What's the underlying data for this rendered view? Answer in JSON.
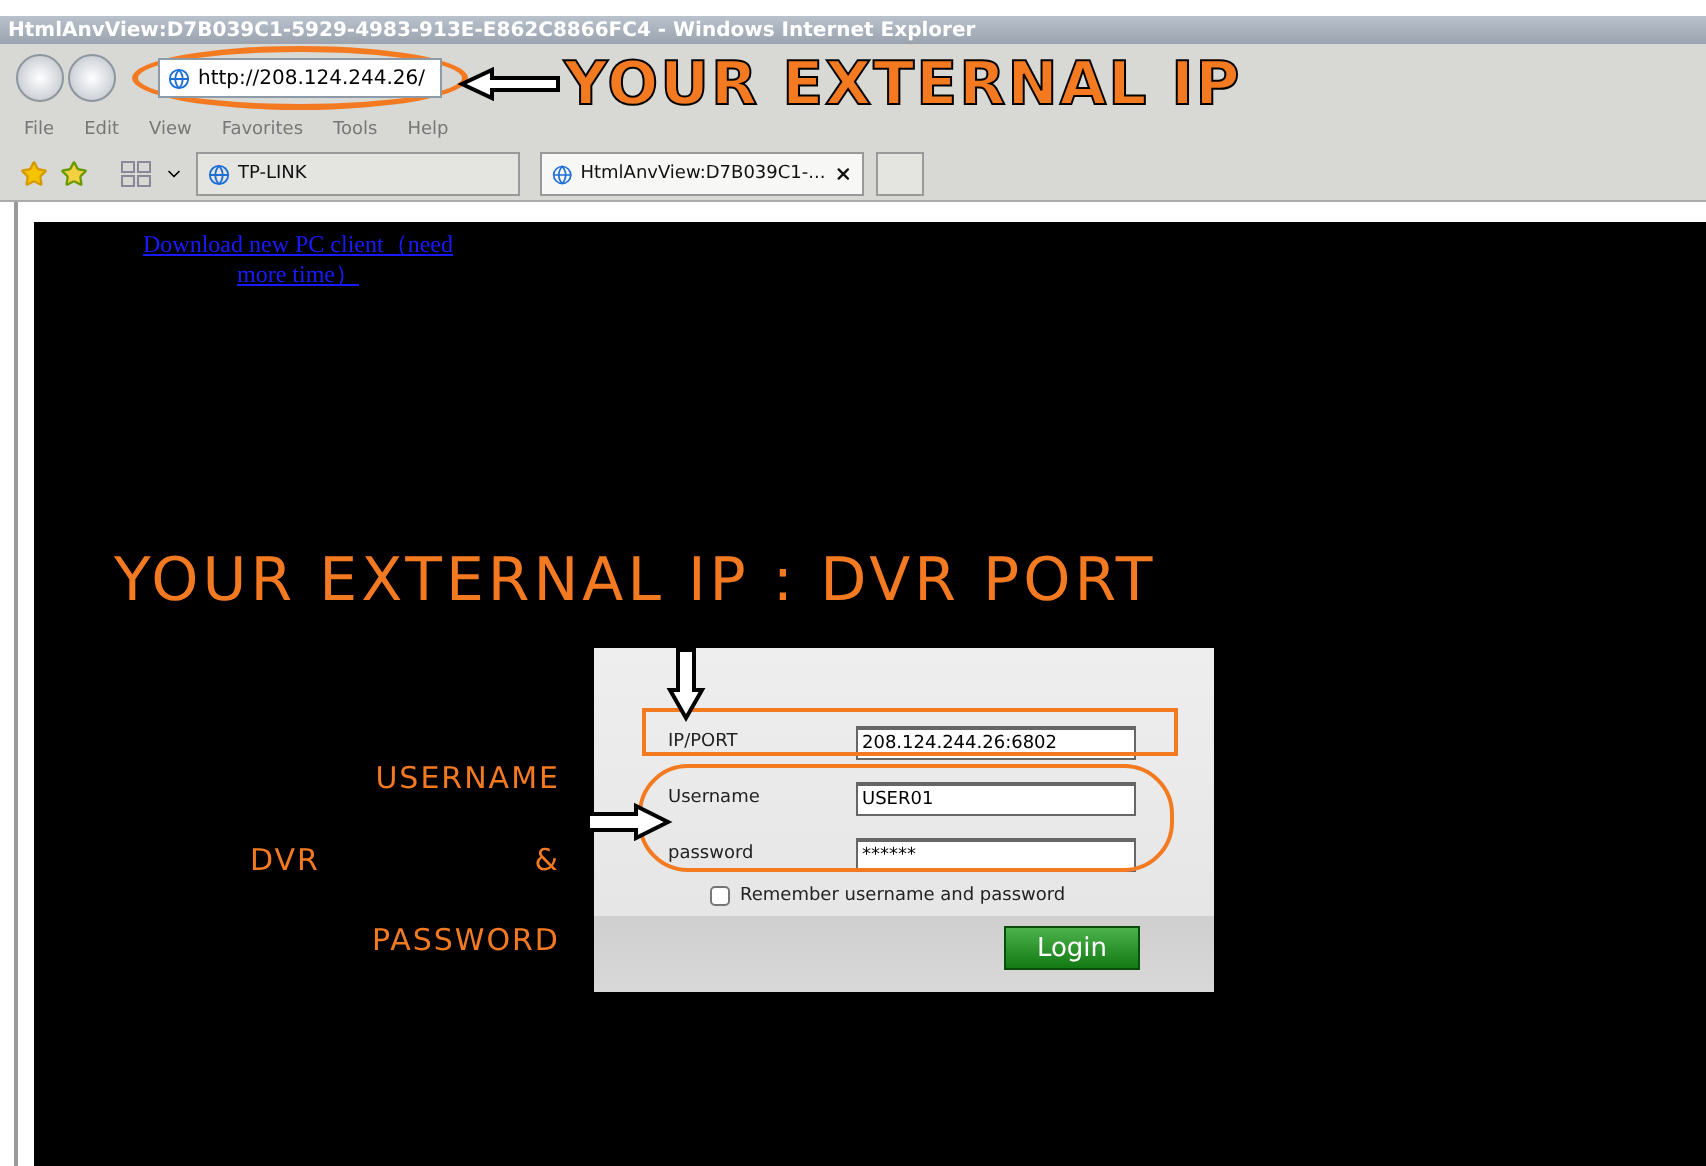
{
  "window": {
    "title": "HtmlAnvView:D7B039C1-5929-4983-913E-E862C8866FC4 - Windows Internet Explorer"
  },
  "address_bar": {
    "url": "http://208.124.244.26/"
  },
  "menu": [
    "File",
    "Edit",
    "View",
    "Favorites",
    "Tools",
    "Help"
  ],
  "tabs": [
    {
      "label": "TP-LINK",
      "selected": false
    },
    {
      "label": "HtmlAnvView:D7B039C1-...",
      "selected": true
    }
  ],
  "page": {
    "download_link": "Download new PC client（need more time）"
  },
  "annotations": {
    "address": "YOUR EXTERNAL IP",
    "port": "YOUR EXTERNAL IP : DVR PORT",
    "credentials": [
      "USERNAME",
      "DVR",
      "&",
      "PASSWORD"
    ]
  },
  "login": {
    "fields": [
      {
        "label": "IP/PORT",
        "value": "208.124.244.26:6802"
      },
      {
        "label": "Username",
        "value": "USER01"
      },
      {
        "label": "password",
        "value": "******"
      }
    ],
    "remember": {
      "label": "Remember username and password",
      "checked": false
    },
    "button": "Login"
  }
}
